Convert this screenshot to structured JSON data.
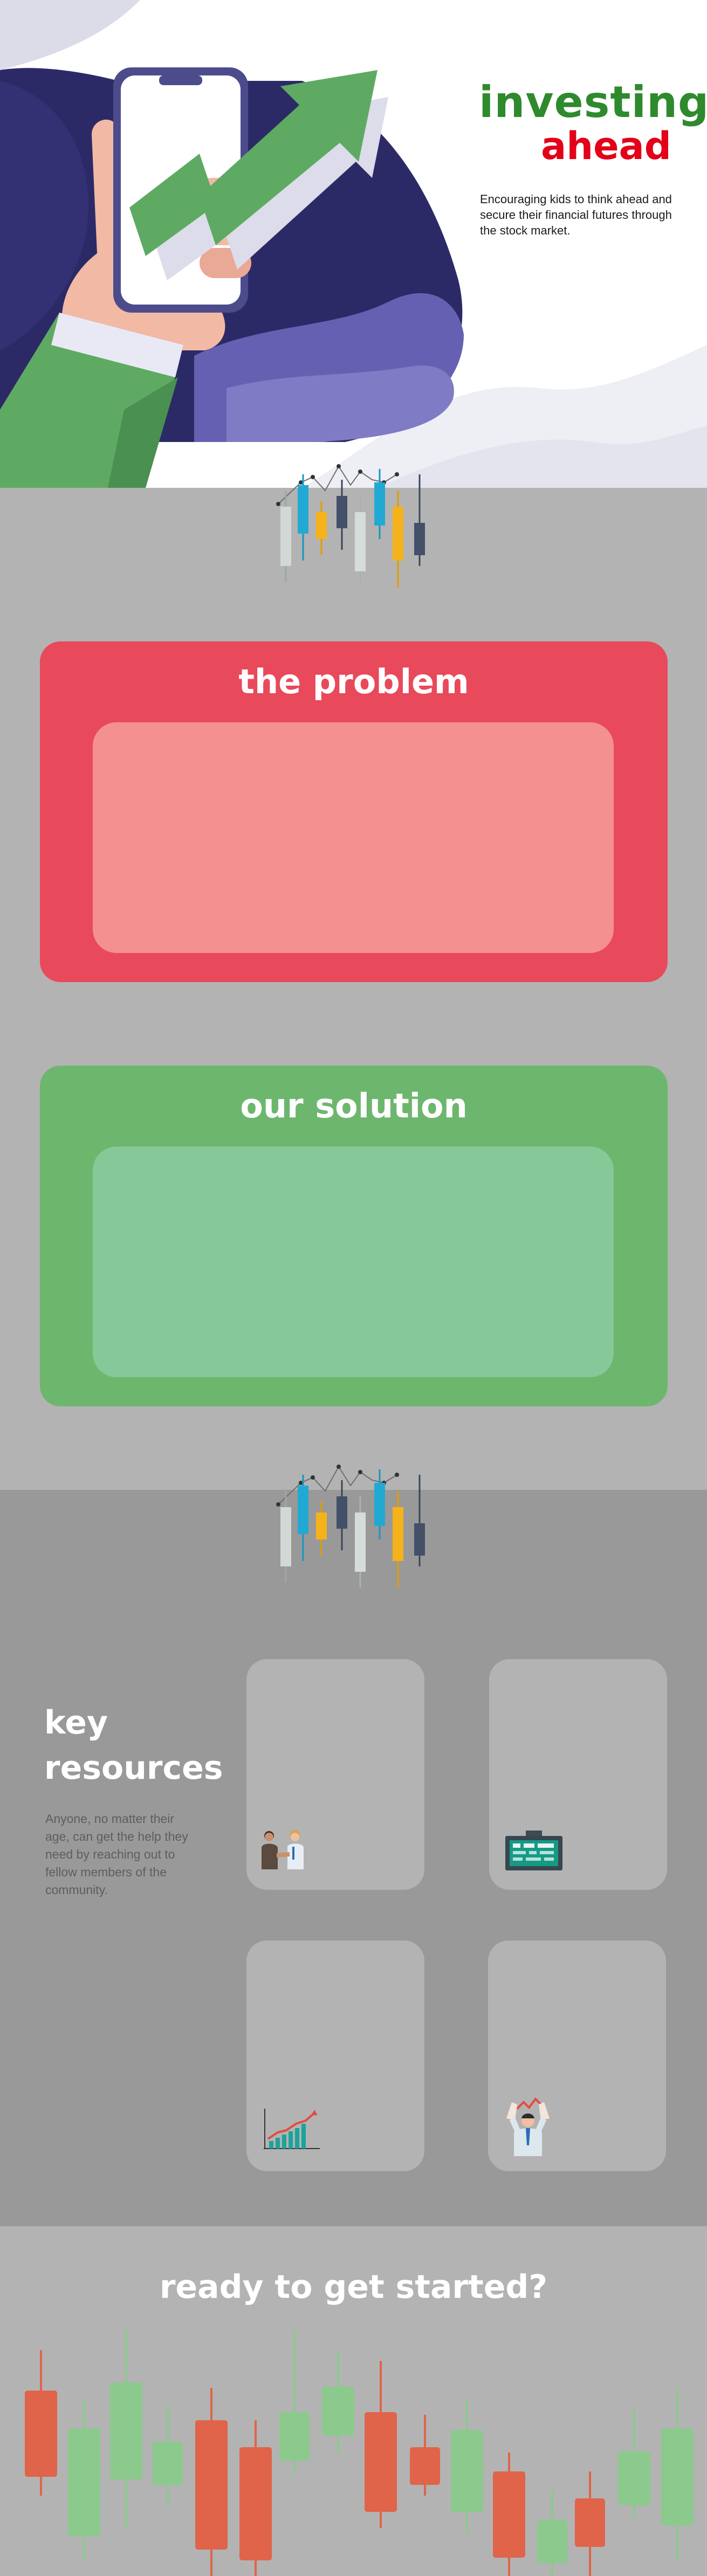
{
  "hero": {
    "title_line1": "investing",
    "title_line2": "ahead",
    "subtitle": "Encouraging kids to think ahead and secure their financial futures through the stock market.",
    "colors": {
      "title_line1": "#2e8a2c",
      "title_line2": "#e30018",
      "arrow": "#5faa63",
      "wave": "#2c2a66"
    }
  },
  "problem": {
    "title": "the problem",
    "colors": {
      "outer": "#e84a5b",
      "inner": "#f4918f"
    }
  },
  "solution": {
    "title": "our solution",
    "colors": {
      "outer": "#6db66e",
      "inner": "#86c897"
    }
  },
  "resources": {
    "title_line1": "key",
    "title_line2": "resources",
    "text": "Anyone, no matter their age, can get the help they need by reaching out to fellow members of the community.",
    "tiles": [
      {
        "icon": "handshake-icon"
      },
      {
        "icon": "trading-monitor-icon"
      },
      {
        "icon": "growth-chart-icon"
      },
      {
        "icon": "celebrating-trader-icon"
      }
    ]
  },
  "cta": {
    "title": "ready to get started?",
    "colors": {
      "down_candle": "#e0644a",
      "up_candle": "#8cc98d"
    }
  },
  "icons": [
    "phone-hand-icon",
    "up-arrow-icon",
    "candlestick-chart-icon"
  ]
}
